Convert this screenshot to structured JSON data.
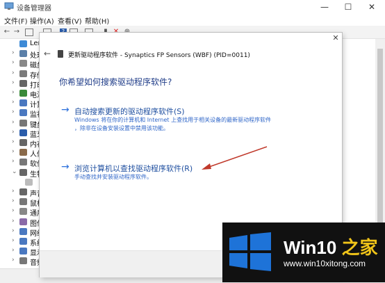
{
  "window": {
    "title": "设备管理器"
  },
  "menu": [
    "文件(F)",
    "操作(A)",
    "查看(V)",
    "帮助(H)"
  ],
  "tree_items": [
    {
      "label": "Ler",
      "expand": ""
    },
    {
      "label": "处理",
      "expand": "›"
    },
    {
      "label": "磁盘",
      "expand": "›"
    },
    {
      "label": "存储",
      "expand": "›"
    },
    {
      "label": "打印",
      "expand": "›"
    },
    {
      "label": "电池",
      "expand": "›"
    },
    {
      "label": "计算",
      "expand": "›"
    },
    {
      "label": "监视",
      "expand": "›"
    },
    {
      "label": "键盘",
      "expand": "›"
    },
    {
      "label": "蓝牙",
      "expand": "›"
    },
    {
      "label": "内存",
      "expand": "›"
    },
    {
      "label": "人体",
      "expand": "›"
    },
    {
      "label": "软件",
      "expand": "›"
    },
    {
      "label": "生物",
      "expand": "⌄"
    },
    {
      "label": "",
      "expand": ""
    },
    {
      "label": "声音",
      "expand": "›"
    },
    {
      "label": "鼠标",
      "expand": "›"
    },
    {
      "label": "通用",
      "expand": "›"
    },
    {
      "label": "图像",
      "expand": "›"
    },
    {
      "label": "网络",
      "expand": "›"
    },
    {
      "label": "系统",
      "expand": "›"
    },
    {
      "label": "显示",
      "expand": "›"
    },
    {
      "label": "音频",
      "expand": "›"
    }
  ],
  "dialog": {
    "title": "更新驱动程序软件 - Synaptics FP Sensors (WBF) (PID=0011)",
    "question": "你希望如何搜索驱动程序软件?",
    "options": [
      {
        "arrow": "→",
        "title": "自动搜索更新的驱动程序软件(S)",
        "description_lines": [
          "Windows 将在你的计算机和 Internet 上查找用于相关设备的最新驱动程序软件",
          "，除非在设备安装设置中禁用该功能。"
        ]
      },
      {
        "arrow": "→",
        "title": "浏览计算机以查找驱动程序软件(R)",
        "description_lines": [
          "手动查找并安装驱动程序软件。"
        ]
      }
    ],
    "close_glyph": "✕",
    "back_glyph": "←"
  },
  "watermark": {
    "brand_main": "Win10",
    "brand_accent": " 之家",
    "url": "www.win10xitong.com"
  },
  "colors": {
    "annotation_arrow": "#c0392b",
    "link_blue": "#1f4fa0",
    "logo_blue": "#1e73d8"
  }
}
